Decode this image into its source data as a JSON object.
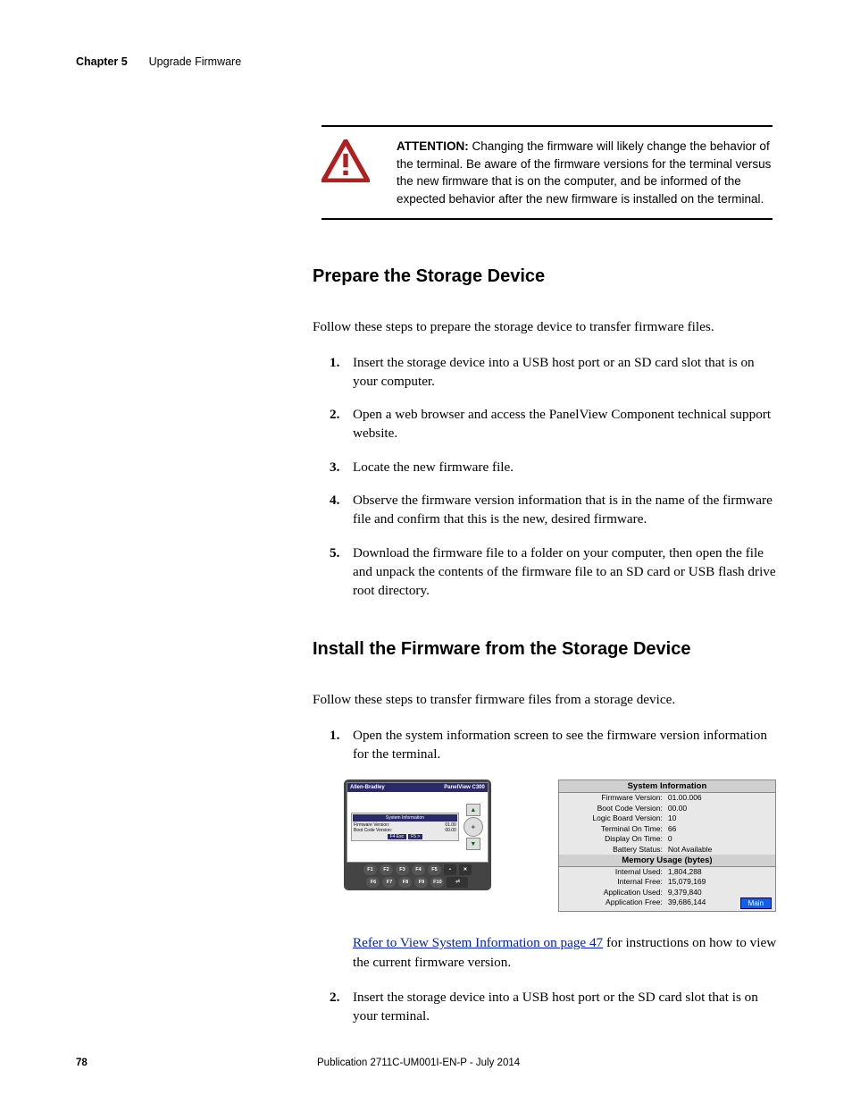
{
  "header": {
    "chapter": "Chapter 5",
    "title": "Upgrade Firmware"
  },
  "attention": {
    "label": "ATTENTION:",
    "text": "Changing the firmware will likely change the behavior of the terminal. Be aware of the firmware versions for the terminal versus the new firmware that is on the computer, and be informed of the expected behavior after the new firmware is installed on the terminal."
  },
  "section1": {
    "heading": "Prepare the Storage Device",
    "intro": "Follow these steps to prepare the storage device to transfer firmware files.",
    "steps": [
      "Insert the storage device into a USB host port or an SD card slot that is on your computer.",
      "Open a web browser and access the PanelView Component technical support website.",
      "Locate the new firmware file.",
      "Observe the firmware version information that is in the name of the firmware file and confirm that this is the new, desired firmware.",
      "Download the firmware file to a folder on your computer, then open the file and unpack the contents of the firmware file to an SD card or USB flash drive root directory."
    ]
  },
  "section2": {
    "heading": "Install the Firmware from the Storage Device",
    "intro": "Follow these steps to transfer firmware files from a storage device.",
    "step1": "Open the system information screen to see the firmware version information for the terminal.",
    "ref_link": "Refer to View System Information on page 47",
    "ref_tail": " for instructions on how to view the current firmware version.",
    "step2": "Insert the storage device into a USB host port or the SD card slot that is on your terminal."
  },
  "device": {
    "brand": "Allen-Bradley",
    "model": "PanelView C300",
    "box_title": "System Information",
    "rows": [
      {
        "l": "Firmware Version:",
        "v": "01.00"
      },
      {
        "l": "Boot Code Version:",
        "v": "00.00"
      }
    ],
    "bottom_btns": [
      "F4 Esc",
      "F5 >"
    ],
    "fkeys_row1": [
      "F1",
      "F2",
      "F3",
      "F4",
      "F5"
    ],
    "fkeys_row2": [
      "F6",
      "F7",
      "F8",
      "F9",
      "F10"
    ]
  },
  "info": {
    "title": "System Information",
    "rows": [
      {
        "l": "Firmware Version:",
        "v": "01.00.006"
      },
      {
        "l": "Boot Code Version:",
        "v": "00.00"
      },
      {
        "l": "Logic Board Version:",
        "v": "10"
      },
      {
        "l": "Terminal On Time:",
        "v": "66"
      },
      {
        "l": "Display On Time:",
        "v": "0"
      },
      {
        "l": "Battery Status:",
        "v": "Not Available"
      }
    ],
    "mem_title": "Memory Usage (bytes)",
    "mem_rows": [
      {
        "l": "Internal Used:",
        "v": "1,804,288"
      },
      {
        "l": "Internal Free:",
        "v": "15,079,169"
      },
      {
        "l": "Application Used:",
        "v": "9,379,840"
      },
      {
        "l": "Application Free:",
        "v": "39,686,144"
      }
    ],
    "main_btn": "Main"
  },
  "footer": {
    "page": "78",
    "pub": "Publication 2711C-UM001I-EN-P - July 2014"
  }
}
